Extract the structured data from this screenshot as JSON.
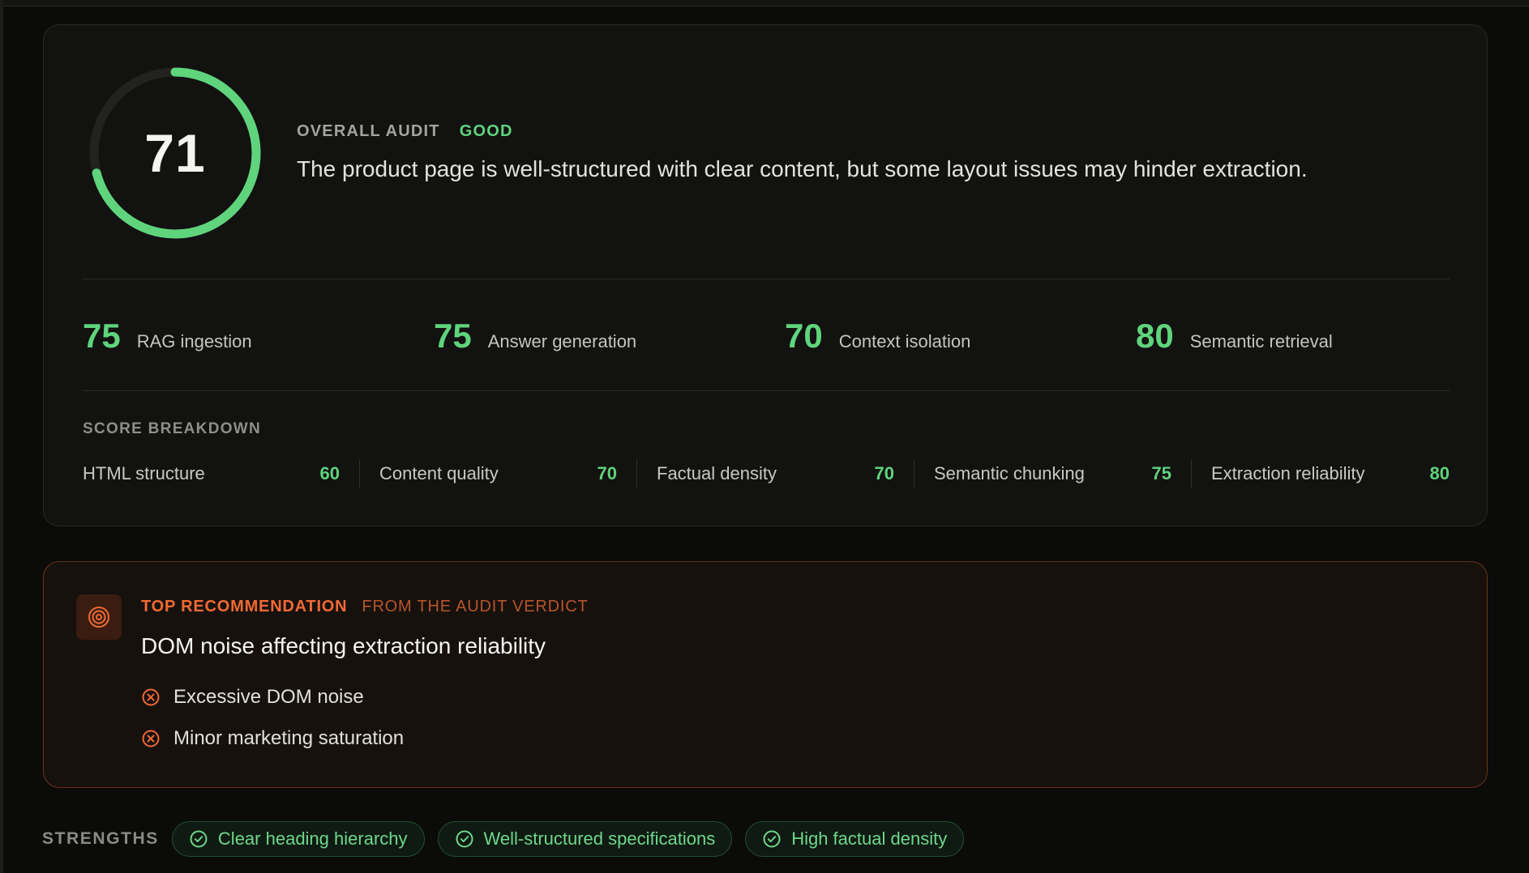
{
  "audit": {
    "score": "71",
    "score_fraction": 0.71,
    "label": "OVERALL AUDIT",
    "rating": "GOOD",
    "summary": "The product page is well-structured with clear content, but some layout issues may hinder extraction."
  },
  "metrics": [
    {
      "value": "75",
      "label": "RAG ingestion"
    },
    {
      "value": "75",
      "label": "Answer generation"
    },
    {
      "value": "70",
      "label": "Context isolation"
    },
    {
      "value": "80",
      "label": "Semantic retrieval"
    }
  ],
  "breakdown": {
    "title": "SCORE BREAKDOWN",
    "items": [
      {
        "label": "HTML structure",
        "value": "60"
      },
      {
        "label": "Content quality",
        "value": "70"
      },
      {
        "label": "Factual density",
        "value": "70"
      },
      {
        "label": "Semantic chunking",
        "value": "75"
      },
      {
        "label": "Extraction reliability",
        "value": "80"
      }
    ]
  },
  "recommendation": {
    "icon": "target-icon",
    "kicker": "TOP RECOMMENDATION",
    "subtitle": "FROM THE AUDIT VERDICT",
    "title": "DOM noise affecting extraction reliability",
    "issues": [
      {
        "icon": "x-circle-icon",
        "text": "Excessive DOM noise"
      },
      {
        "icon": "x-circle-icon",
        "text": "Minor marketing saturation"
      }
    ]
  },
  "strengths": {
    "label": "STRENGTHS",
    "items": [
      {
        "icon": "check-circle-icon",
        "text": "Clear heading hierarchy"
      },
      {
        "icon": "check-circle-icon",
        "text": "Well-structured specifications"
      },
      {
        "icon": "check-circle-icon",
        "text": "High factual density"
      }
    ]
  },
  "colors": {
    "accent_green": "#5fd47c",
    "accent_orange": "#f06a34",
    "card_bg": "#121211",
    "page_bg": "#0b0b0a"
  }
}
